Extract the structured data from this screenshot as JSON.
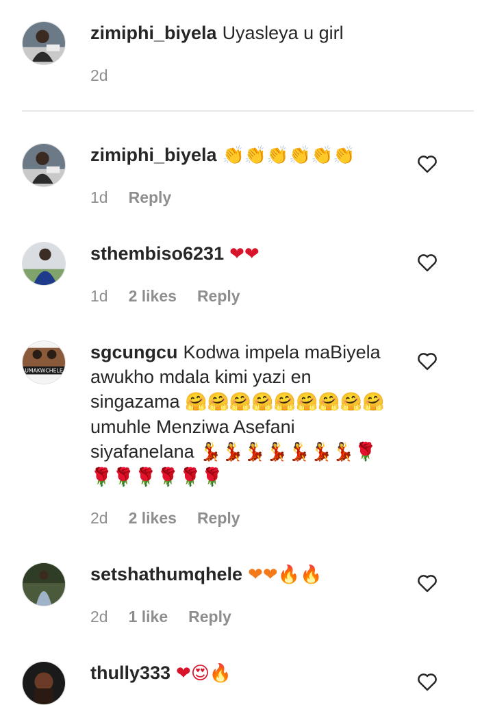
{
  "caption": {
    "username": "zimiphi_biyela",
    "text": "Uyasleya u girl",
    "time": "2d"
  },
  "comments": [
    {
      "username": "zimiphi_biyela",
      "emoji": "👏👏👏👏👏👏",
      "time": "1d",
      "reply": "Reply"
    },
    {
      "username": "sthembiso6231",
      "emoji": "❤❤",
      "time": "1d",
      "likes": "2 likes",
      "reply": "Reply"
    },
    {
      "username": "sgcungcu",
      "text_1": "Kodwa impela maBiyela awukho mdala kimi yazi en singazama",
      "emoji_1": "🤗🤗🤗🤗🤗🤗🤗🤗🤗",
      "text_2": "umuhle Menziwa Asefani siyafanelana",
      "emoji_2": "💃💃💃💃💃💃💃🌹🌹🌹🌹🌹🌹🌹",
      "time": "2d",
      "likes": "2 likes",
      "reply": "Reply",
      "avatar_caption": "UMAKWCHELE"
    },
    {
      "username": "setshathumqhele",
      "emoji": "❤❤🔥🔥",
      "time": "2d",
      "likes": "1 like",
      "reply": "Reply"
    },
    {
      "username": "thully333",
      "emoji": "❤😍🔥"
    }
  ],
  "icons": {
    "like": "heart-outline-icon"
  }
}
